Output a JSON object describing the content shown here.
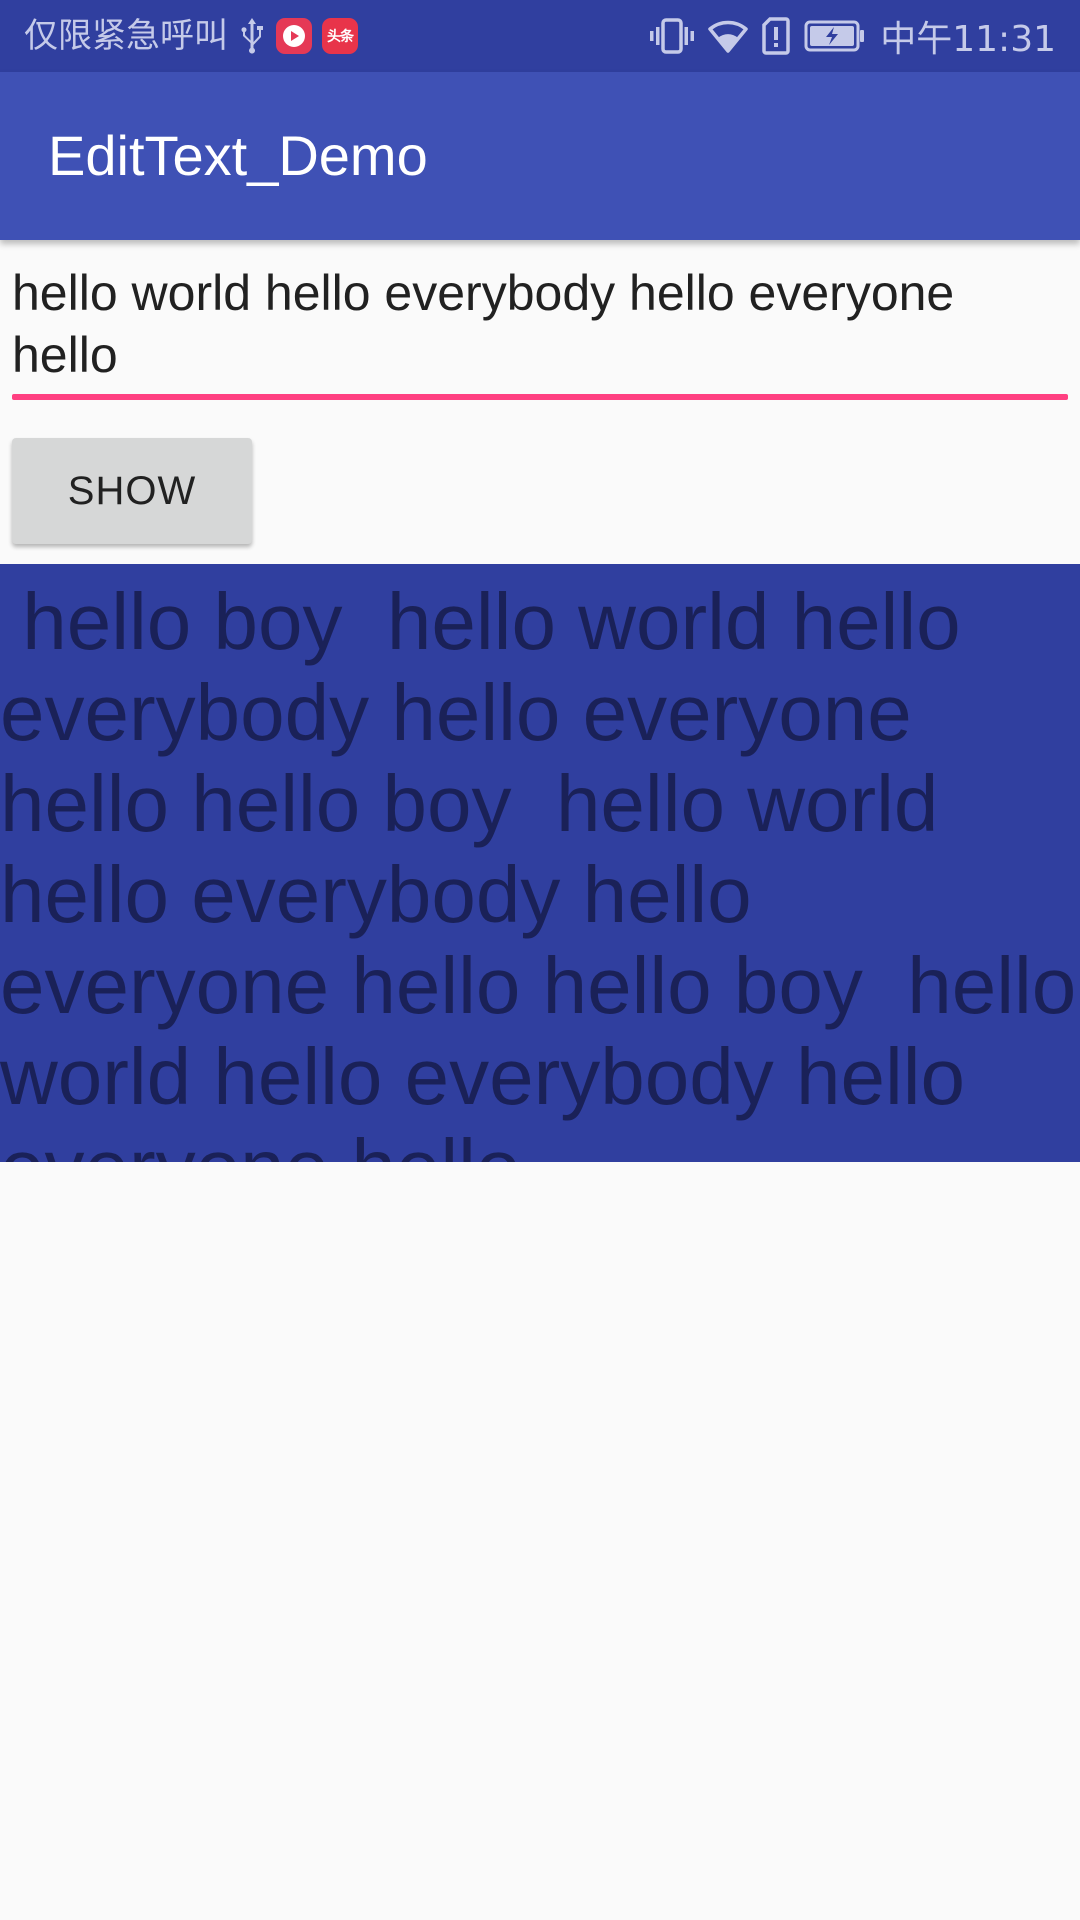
{
  "status_bar": {
    "carrier_text": "仅限紧急呼叫",
    "clock": "中午11:31",
    "toutiao_label": "头条",
    "icons": [
      "usb-icon",
      "video-app-icon",
      "toutiao-app-icon",
      "vibrate-icon",
      "wifi-icon",
      "alert-icon",
      "battery-charging-icon"
    ]
  },
  "app_bar": {
    "title": "EditText_Demo"
  },
  "edit_text": {
    "value": "hello world hello everybody hello everyone hello"
  },
  "show_button": {
    "label": "SHOW"
  },
  "display": {
    "text": " hello boy  hello world hello everybody hello everyone hello hello boy  hello world hello everybody hello everyone hello hello boy  hello world hello everybody hello everyone hello"
  },
  "colors": {
    "status_bar": "#303F9F",
    "app_bar": "#3F51B5",
    "accent": "#FF4081",
    "display_background": "#303F9F",
    "display_text": "#1A2158",
    "button": "#D6D7D7"
  }
}
